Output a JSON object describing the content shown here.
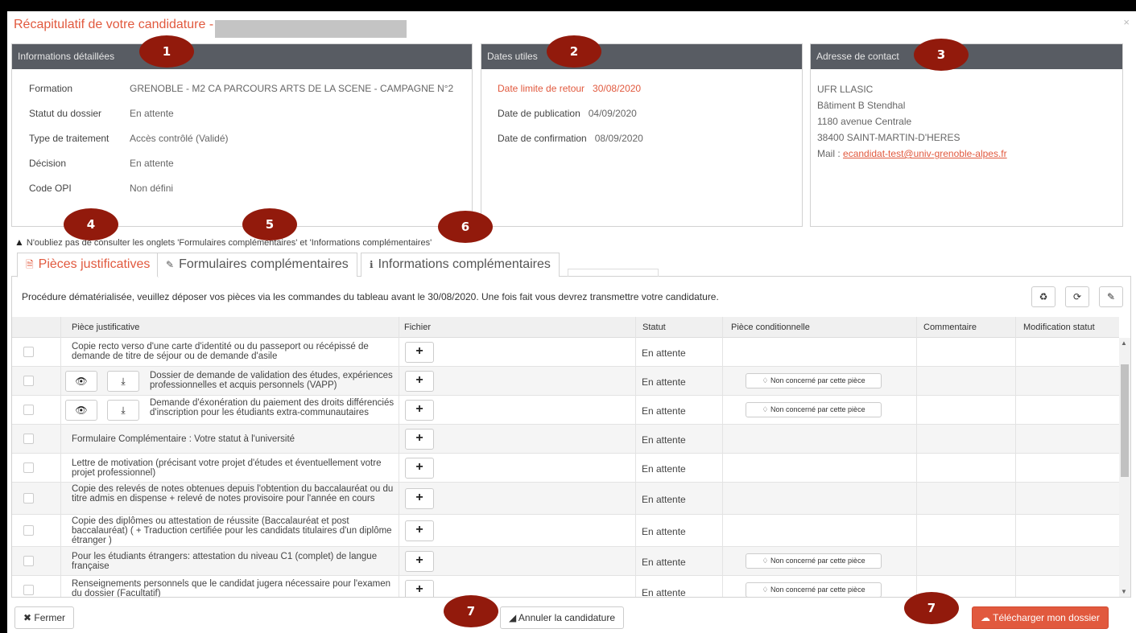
{
  "modal": {
    "title": "Récapitulatif de votre candidature -",
    "close": "×"
  },
  "info": {
    "header": "Informations détaillées",
    "rows": [
      {
        "label": "Formation",
        "value": "GRENOBLE - M2 CA PARCOURS ARTS DE LA SCENE - CAMPAGNE N°2"
      },
      {
        "label": "Statut du dossier",
        "value": "En attente"
      },
      {
        "label": "Type de traitement",
        "value": "Accès contrôlé (Validé)"
      },
      {
        "label": "Décision",
        "value": "En attente"
      },
      {
        "label": "Code OPI",
        "value": "Non défini"
      }
    ]
  },
  "dates": {
    "header": "Dates utiles",
    "rows": [
      {
        "label": "Date limite de retour",
        "value": "30/08/2020"
      },
      {
        "label": "Date de publication",
        "value": "04/09/2020"
      },
      {
        "label": "Date de confirmation",
        "value": "08/09/2020"
      }
    ]
  },
  "contact": {
    "header": "Adresse de contact",
    "lines": [
      "UFR LLASIC",
      "Bâtiment B Stendhal",
      "1180 avenue Centrale",
      "38400 SAINT-MARTIN-D'HERES"
    ],
    "mail_label": "Mail : ",
    "mail": "ecandidat-test@univ-grenoble-alpes.fr"
  },
  "badges": [
    "1",
    "2",
    "3",
    "4",
    "5",
    "6",
    "7",
    "7"
  ],
  "warning": "N'oubliez pas de consulter les onglets 'Formulaires complémentaires' et 'Informations complémentaires'",
  "tabs": [
    {
      "label": "Pièces justificatives",
      "icon": "document-icon"
    },
    {
      "label": "Formulaires complémentaires",
      "icon": "edit-icon"
    },
    {
      "label": "Informations complémentaires",
      "icon": "info-icon"
    }
  ],
  "procedure_text": "Procédure dématérialisée, veuillez déposer vos pièces via les commandes du tableau avant le 30/08/2020. Une fois fait vous devrez transmettre votre candidature.",
  "toolbar_icons": [
    "recycle-icon",
    "refresh-icon",
    "pencil-icon"
  ],
  "table": {
    "headers": [
      "Pièce justificative",
      "Fichier",
      "Statut",
      "Pièce conditionnelle",
      "Commentaire",
      "Modification statut"
    ],
    "rows": [
      {
        "piece": "Copie recto verso d'une carte d'identité ou du passeport ou récépissé de demande de titre de séjour ou de demande d'asile",
        "statut": "En attente",
        "conditionnelle": "",
        "has_file": false
      },
      {
        "piece": "Dossier de demande de validation des études, expériences professionnelles et acquis personnels (VAPP)",
        "statut": "En attente",
        "conditionnelle": "Non concerné par cette pièce",
        "has_file": true
      },
      {
        "piece": "Demande d'éxonération du paiement des droits différenciés d'inscription pour les étudiants extra-communautaires",
        "statut": "En attente",
        "conditionnelle": "Non concerné par cette pièce",
        "has_file": true
      },
      {
        "piece": "Formulaire Complémentaire : Votre statut à l'université",
        "statut": "En attente",
        "conditionnelle": "",
        "has_file": false
      },
      {
        "piece": "Lettre de motivation (précisant votre projet d'études et éventuellement votre projet professionnel)",
        "statut": "En attente",
        "conditionnelle": "",
        "has_file": false
      },
      {
        "piece": "Copie des relevés de notes obtenues depuis l'obtention du baccalauréat ou du titre admis en dispense + relevé de notes provisoire pour l'année en cours",
        "statut": "En attente",
        "conditionnelle": "",
        "has_file": false
      },
      {
        "piece": "Copie des diplômes ou attestation de réussite (Baccalauréat et post baccalauréat) ( + Traduction certifiée pour les candidats titulaires d'un diplôme étranger )",
        "statut": "En attente",
        "conditionnelle": "",
        "has_file": false
      },
      {
        "piece": "Pour les étudiants étrangers: attestation du niveau C1 (complet) de langue française",
        "statut": "En attente",
        "conditionnelle": "Non concerné par cette pièce",
        "has_file": false
      },
      {
        "piece": "Renseignements personnels que le candidat jugera nécessaire pour l'examen du dossier (Facultatif)",
        "statut": "En attente",
        "conditionnelle": "Non concerné par cette pièce",
        "has_file": false
      }
    ]
  },
  "footer": {
    "close": "Fermer",
    "cancel": "Annuler la candidature",
    "download": "Télécharger mon dossier"
  },
  "colors": {
    "accent": "#e1593e",
    "badge": "#921a0c",
    "panel_header": "#585c63"
  }
}
